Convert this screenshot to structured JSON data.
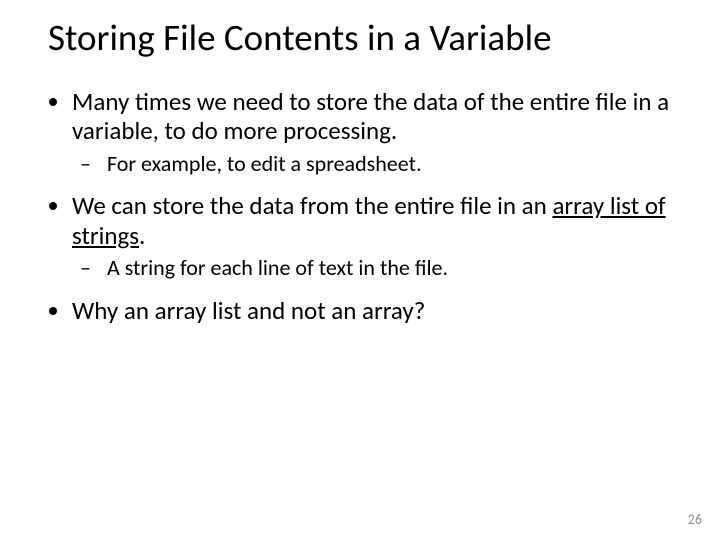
{
  "slide": {
    "title": "Storing File Contents in a Variable",
    "bullets": [
      {
        "text_before": "Many times we need to store the data of the entire file in a variable, to do more processing.",
        "sub": [
          "For example, to edit a spreadsheet."
        ]
      },
      {
        "text_before": "We can store the data from the entire file in an ",
        "underline": "array list of strings",
        "text_after": ".",
        "sub": [
          "A string for each line of text in the file."
        ]
      },
      {
        "text_before": "Why an array list and not an array?"
      }
    ],
    "page_number": "26"
  }
}
